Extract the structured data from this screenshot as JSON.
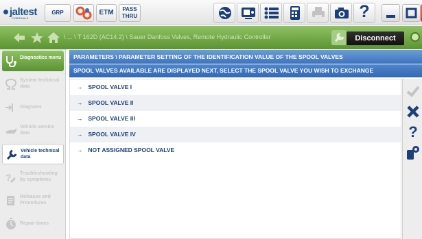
{
  "toolbar": {
    "logo": "jaltest",
    "logo_sub": "CYBERUALS",
    "grp_label": "GRP",
    "etm_label": "ETM",
    "pass_label_1": "PASS",
    "pass_label_2": "THRU",
    "help_label": "?"
  },
  "nav": {
    "path": "\\ ... \\ T 162D (AC14.2) \\ Sauer Danfoss Valves, Remote Hydraulic Controller",
    "disconnect_label": "Disconnect"
  },
  "sidebar": {
    "items": [
      {
        "label": "Diagnostics menu"
      },
      {
        "label": "System technical data"
      },
      {
        "label": "Diagrams"
      },
      {
        "label": "Vehicle service data"
      },
      {
        "label": "Vehicle technical data"
      },
      {
        "label": "Troubleshooting by symptoms"
      },
      {
        "label": "Releases and Procedures"
      },
      {
        "label": "Repair times"
      }
    ]
  },
  "content": {
    "title": "PARAMETERS \\ PARAMETER SETTING OF THE IDENTIFICATION VALUE OF THE SPOOL VALVES",
    "instruction": "SPOOL VALVES AVAILABLE ARE DISPLAYED NEXT, SELECT THE SPOOL VALVE YOU WISH TO EXCHANGE",
    "arrow": "→",
    "rows": [
      {
        "label": "SPOOL VALVE I"
      },
      {
        "label": "SPOOL VALVE II"
      },
      {
        "label": "SPOOL VALVE III"
      },
      {
        "label": "SPOOL VALVE IV"
      },
      {
        "label": "NOT ASSIGNED SPOOL VALVE"
      }
    ]
  },
  "actions": {
    "help_label": "?"
  },
  "colors": {
    "accent_green": "#6fa548",
    "header_blue": "#4a7fc4",
    "text_blue": "#1b3f78",
    "close_red": "#e64a2a"
  }
}
